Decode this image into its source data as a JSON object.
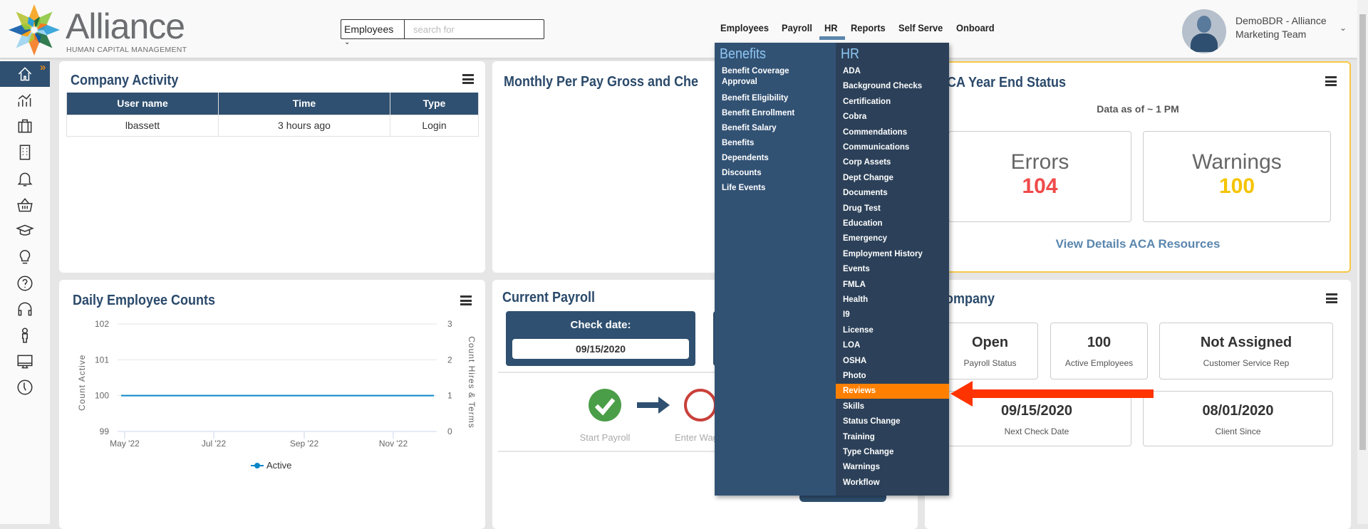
{
  "header": {
    "logo_word": "Alliance",
    "logo_sub": "HUMAN CAPITAL MANAGEMENT",
    "search_scope": "Employees",
    "search_placeholder": "search for",
    "nav": [
      "Employees",
      "Payroll",
      "HR",
      "Reports",
      "Self Serve",
      "Onboard"
    ],
    "active_nav": "HR",
    "user_line1": "DemoBDR - Alliance",
    "user_line2": "Marketing Team"
  },
  "sidebar": {
    "items": [
      "home-icon",
      "analytics-icon",
      "briefcase-icon",
      "building-icon",
      "bell-icon",
      "basket-icon",
      "graduation-cap-icon",
      "lightbulb-icon",
      "help-icon",
      "headset-icon",
      "person-icon",
      "monitor-icon",
      "clock-icon"
    ],
    "active": "home-icon"
  },
  "company_activity": {
    "title": "Company Activity",
    "columns": [
      "User name",
      "Time",
      "Type"
    ],
    "rows": [
      [
        "lbassett",
        "3 hours ago",
        "Login"
      ]
    ]
  },
  "monthly": {
    "title": "Monthly Per Pay Gross and Che"
  },
  "aca": {
    "title": "ACA Year End Status",
    "data_as_of": "Data as of ~ 1 PM",
    "errors_label": "Errors",
    "errors_value": "104",
    "warnings_label": "Warnings",
    "warnings_value": "100",
    "link": "View Details ACA Resources",
    "colors": {
      "errors": "#f04b4b",
      "warnings": "#f5c400",
      "border": "#f7c948"
    }
  },
  "daily": {
    "title": "Daily Employee Counts"
  },
  "chart_data": {
    "type": "line",
    "title": "Daily Employee Counts",
    "x_ticks": [
      "May '22",
      "Jul '22",
      "Sep '22",
      "Nov '22"
    ],
    "ylabel": "Count Active",
    "ylabel_right": "Count Hires & Terms",
    "ylim": [
      99,
      102
    ],
    "yticks": [
      "99",
      "100",
      "101",
      "102"
    ],
    "ylim_right": [
      0,
      3
    ],
    "yticks_right": [
      "0",
      "1",
      "2",
      "3"
    ],
    "series": [
      {
        "name": "Active",
        "color": "#0a86c8",
        "values": [
          100,
          100
        ]
      }
    ],
    "x_range": [
      "May '22",
      "Dec '22"
    ],
    "legend": "bottom",
    "grid": true
  },
  "payroll": {
    "title": "Current Payroll",
    "check_date_label": "Check date:",
    "check_date": "09/15/2020",
    "steps": [
      "Start Payroll",
      "Enter Wag"
    ]
  },
  "company": {
    "title": "Company",
    "stats": [
      {
        "value": "Open",
        "label": "Payroll Status"
      },
      {
        "value": "100",
        "label": "Active Employees"
      },
      {
        "value": "Not Assigned",
        "label": "Customer Service Rep"
      },
      {
        "value": "09/15/2020",
        "label": "Next Check Date"
      },
      {
        "value": "08/01/2020",
        "label": "Client Since"
      }
    ]
  },
  "menu": {
    "benefits_header": "Benefits",
    "benefits": [
      "Benefit Coverage Approval",
      "Benefit Eligibility",
      "Benefit Enrollment",
      "Benefit Salary",
      "Benefits",
      "Dependents",
      "Discounts",
      "Life Events"
    ],
    "hr_header": "HR",
    "hr": [
      "ADA",
      "Background Checks",
      "Certification",
      "Cobra",
      "Commendations",
      "Communications",
      "Corp Assets",
      "Dept Change",
      "Documents",
      "Drug Test",
      "Education",
      "Emergency",
      "Employment History",
      "Events",
      "FMLA",
      "Health",
      "I9",
      "License",
      "LOA",
      "OSHA",
      "Photo",
      "Reviews",
      "Skills",
      "Status Change",
      "Training",
      "Type Change",
      "Warnings",
      "Workflow"
    ],
    "highlighted": "Reviews",
    "highlight_color": "#ff8000"
  },
  "annotation": {
    "arrow_color": "#ff3300"
  }
}
